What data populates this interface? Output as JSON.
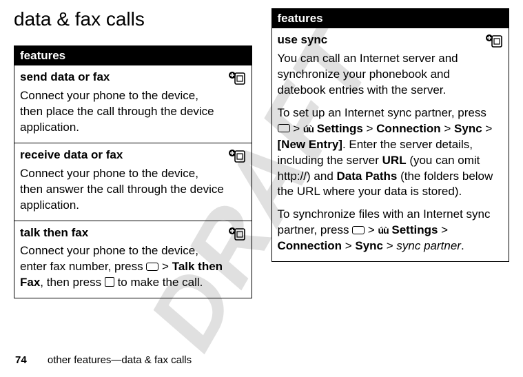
{
  "watermark": "DRAFT",
  "title": "data & fax calls",
  "left_table": {
    "header": "features",
    "rows": [
      {
        "name": "send data or fax",
        "body": "Connect your phone to the device, then place the call through the device application."
      },
      {
        "name": "receive data or fax",
        "body": "Connect your phone to the device, then answer the call through the device application."
      },
      {
        "name": "talk then fax",
        "body_pre": "Connect your phone to the device, enter fax number, press ",
        "body_mid": " > ",
        "body_bold1": "Talk then Fax",
        "body_post1": ", then press ",
        "body_post2": " to make the call."
      }
    ]
  },
  "right_table": {
    "header": "features",
    "row": {
      "name": "use sync",
      "p1": "You can call an Internet server and synchronize your phonebook and datebook entries with the server.",
      "p2_pre": "To set up an Internet sync partner, press ",
      "sep": " > ",
      "settings": "Settings",
      "connection": "Connection",
      "sync": "Sync",
      "new_entry": "[New Entry]",
      "p2_mid": ". Enter the server details, including the server ",
      "url": "URL",
      "p2_mid2": " (you can omit http://) and ",
      "data_paths": "Data Paths",
      "p2_end": " (the folders below the URL where your data is stored).",
      "p3_pre": "To synchronize files with an Internet sync partner, press ",
      "sync_partner": "sync partner",
      "period": "."
    }
  },
  "footer": {
    "page_number": "74",
    "breadcrumb": "other features—data & fax calls"
  }
}
